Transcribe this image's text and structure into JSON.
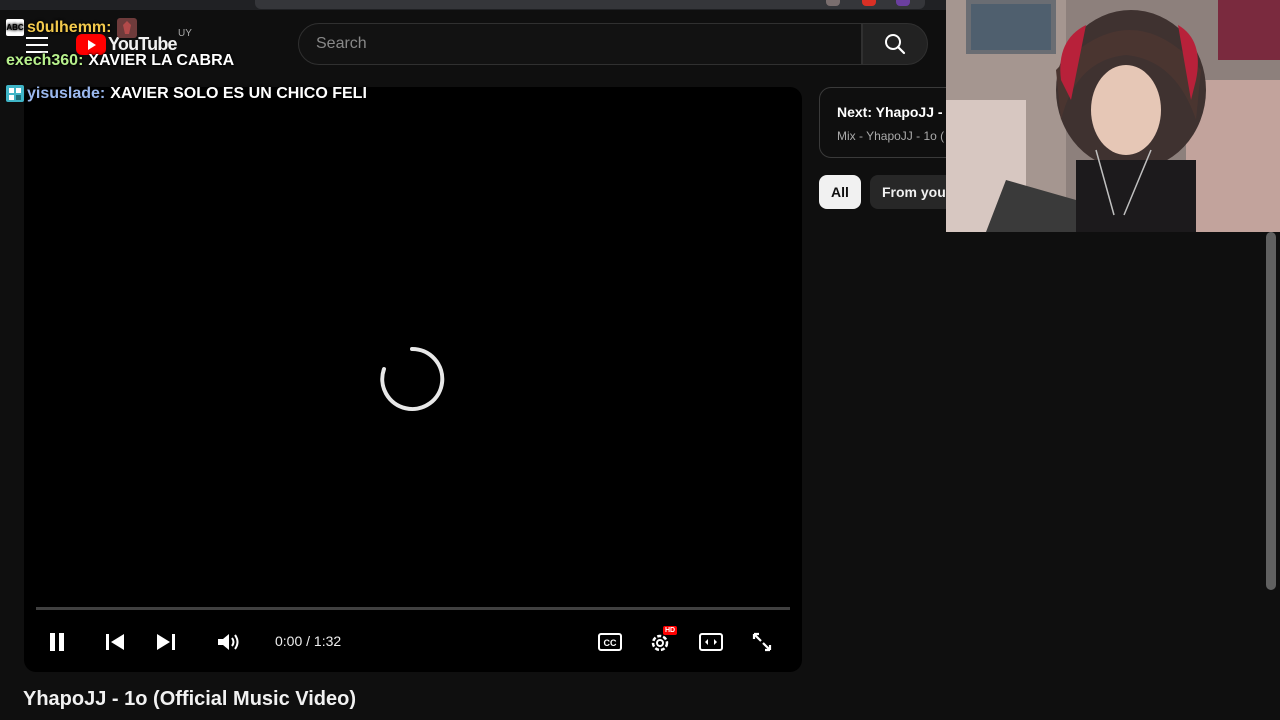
{
  "chat": [
    {
      "user": "s0ulhemm:",
      "message": "",
      "user_color": "#f2c94c",
      "badge": "ABC",
      "badge_color": "#ffffff",
      "badge_text_color": "#000000"
    },
    {
      "user": "exech360:",
      "message": "XAVIER LA CABRA",
      "user_color": "#b7f08c",
      "badge": "",
      "badge_color": "",
      "badge_text_color": ""
    },
    {
      "user": "yisuslade:",
      "message": "XAVIER SOLO ES UN CHICO FELI",
      "user_color": "#9ab8ee",
      "badge": "",
      "badge_color": "#3fb5c7",
      "badge_text_color": ""
    }
  ],
  "masthead": {
    "logo_text": "YouTube",
    "country_code": "UY",
    "search_placeholder": "Search"
  },
  "player": {
    "time_display": "0:00 / 1:32",
    "progress": 0,
    "accent": "#ff0000",
    "hd_badge": "HD"
  },
  "video": {
    "title": "YhapoJJ - 1o (Official Music Video)"
  },
  "next_card": {
    "title": "Next: YhapoJJ - l",
    "subtitle": "Mix - YhapoJJ - 1o ("
  },
  "chips": {
    "all": "All",
    "from": "From your"
  },
  "icons": [
    "menu-icon",
    "search-icon",
    "pause-icon",
    "previous-icon",
    "next-icon",
    "volume-icon",
    "captions-icon",
    "settings-icon",
    "theater-mode-icon",
    "fullscreen-icon",
    "loading-spinner"
  ]
}
